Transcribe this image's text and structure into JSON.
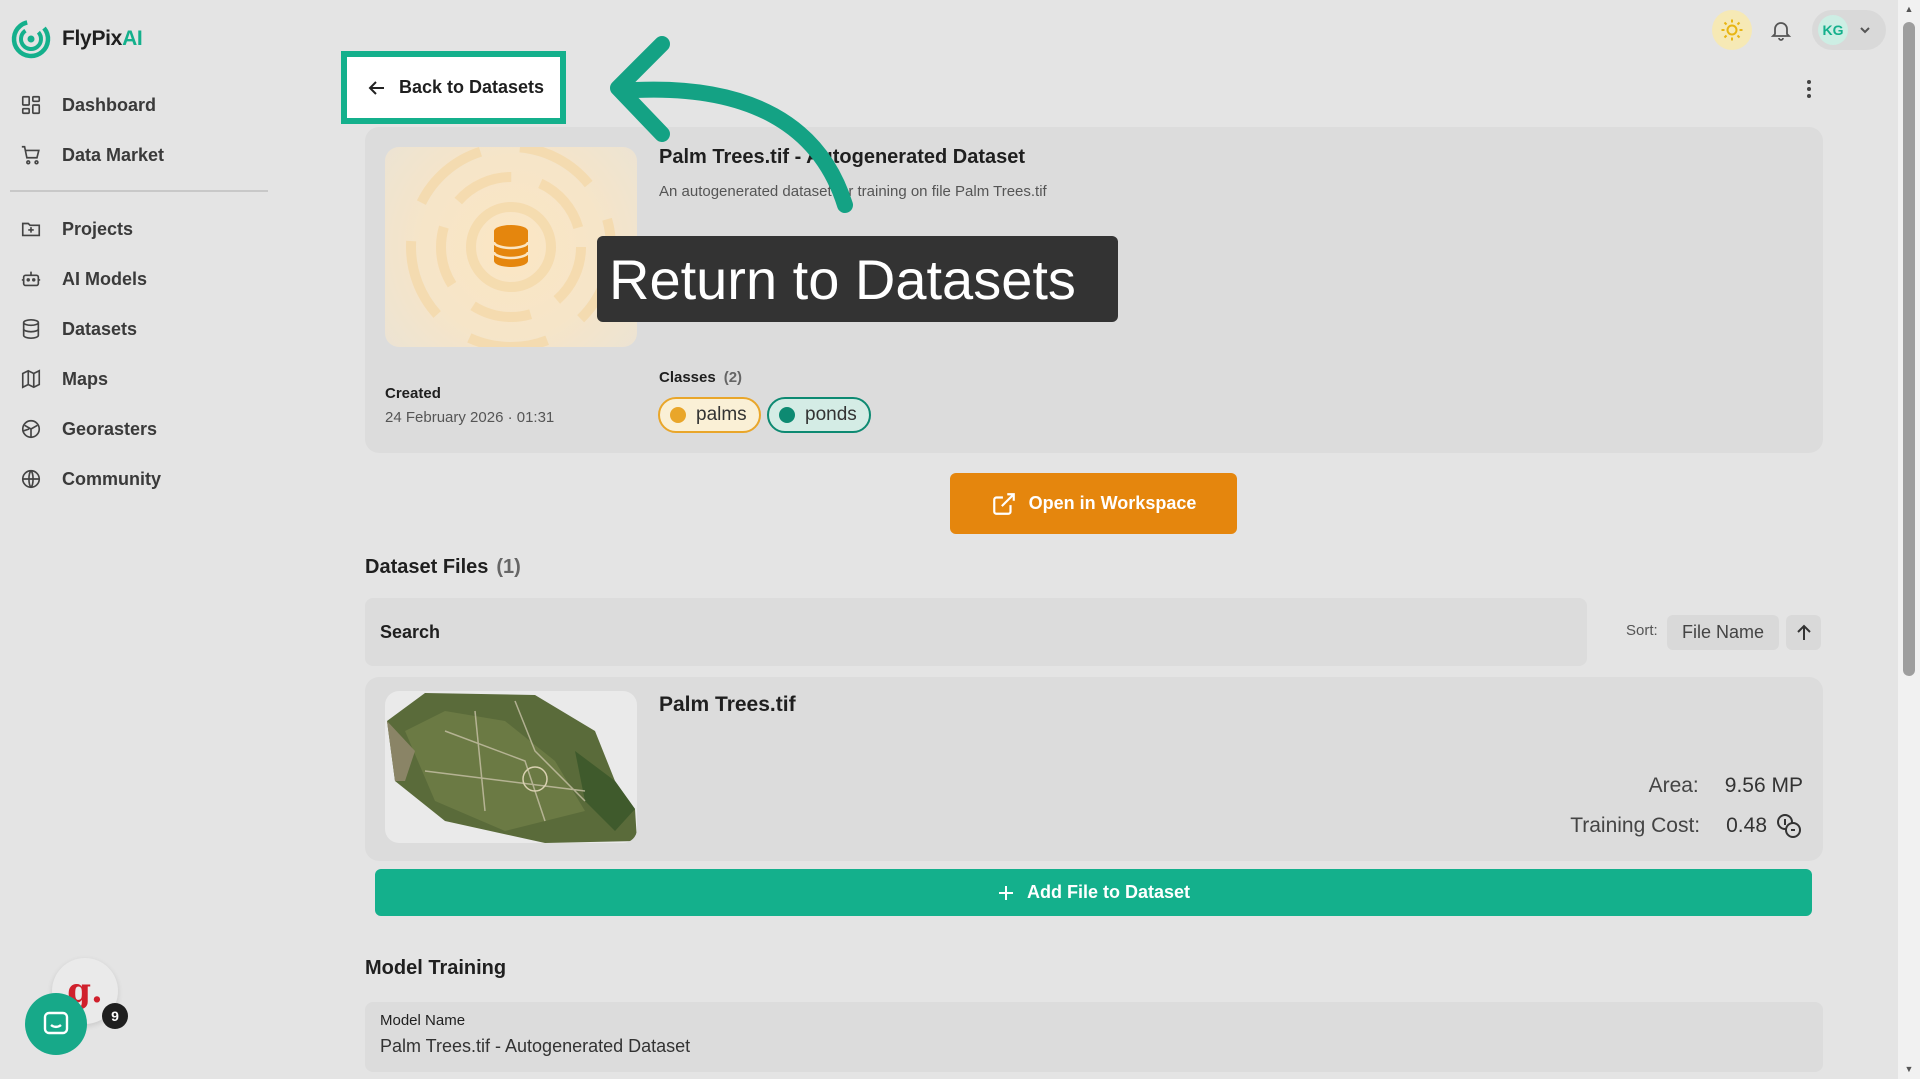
{
  "app": {
    "brand_prefix": "FlyPix",
    "brand_suffix": "AI"
  },
  "sidebar": {
    "items_top": [
      {
        "label": "Dashboard",
        "icon": "dashboard-icon"
      },
      {
        "label": "Data Market",
        "icon": "cart-icon"
      }
    ],
    "items_main": [
      {
        "label": "Projects",
        "icon": "folder-icon"
      },
      {
        "label": "AI Models",
        "icon": "robot-icon"
      },
      {
        "label": "Datasets",
        "icon": "database-icon"
      },
      {
        "label": "Maps",
        "icon": "map-icon"
      },
      {
        "label": "Georasters",
        "icon": "globe-grid-icon"
      },
      {
        "label": "Community",
        "icon": "globe-icon"
      }
    ]
  },
  "header": {
    "user_initials": "KG",
    "back_label": "Back to Datasets"
  },
  "dataset": {
    "title": "Palm Trees.tif - Autogenerated Dataset",
    "description": "An autogenerated dataset for training on file Palm Trees.tif",
    "created_label": "Created",
    "created_date": "24 February 2026 · 01:31",
    "classes_label": "Classes",
    "classes_count": "(2)",
    "classes": [
      {
        "name": "palms",
        "color": "#e9a62a"
      },
      {
        "name": "ponds",
        "color": "#0d8a72"
      }
    ]
  },
  "overlay": {
    "tooltip": "Return to Datasets"
  },
  "actions": {
    "open_workspace": "Open in Workspace",
    "add_file": "Add File to Dataset"
  },
  "files": {
    "title": "Dataset Files",
    "count": "(1)",
    "search_placeholder": "Search",
    "sort_label": "Sort:",
    "sort_value": "File Name",
    "items": [
      {
        "name": "Palm Trees.tif",
        "area_label": "Area:",
        "area_value": "9.56 MP",
        "cost_label": "Training Cost:",
        "cost_value": "0.48"
      }
    ]
  },
  "training": {
    "title": "Model Training",
    "model_name_label": "Model Name",
    "model_name_value": "Palm Trees.tif - Autogenerated Dataset"
  },
  "widgets": {
    "g_letter": "g.",
    "badge_count": "9"
  },
  "colors": {
    "accent": "#14b08c",
    "orange": "#e5860d",
    "background": "#e4e4e4"
  }
}
